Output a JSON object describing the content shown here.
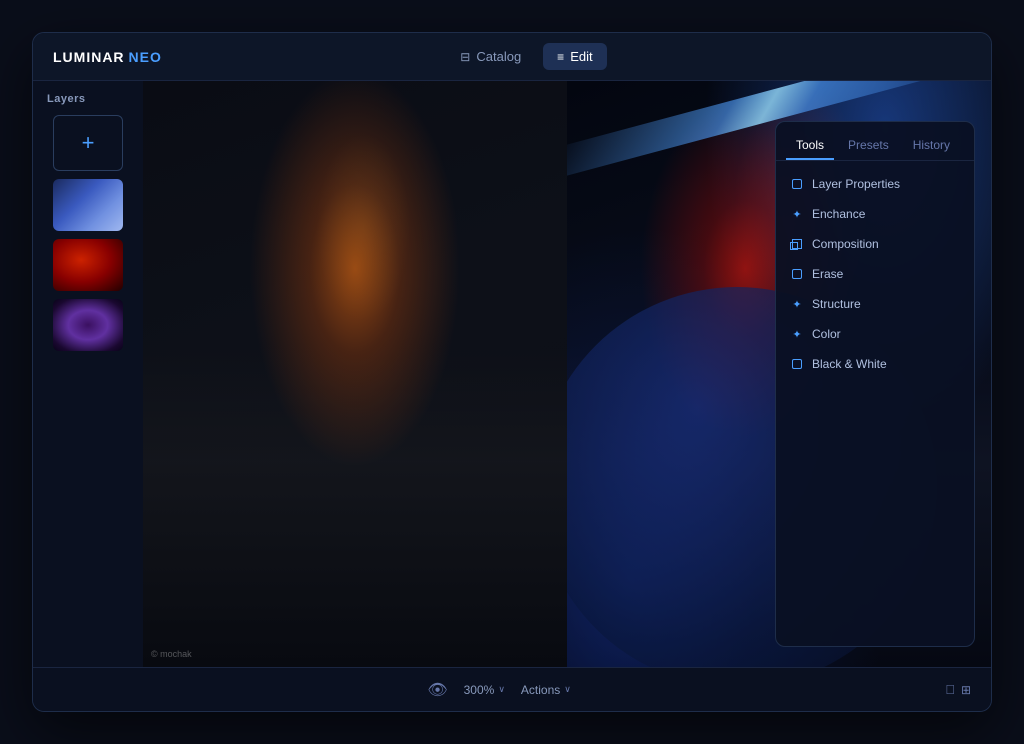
{
  "app": {
    "title_luminar": "LUMINAR",
    "title_neo": "NEO"
  },
  "titlebar": {
    "catalog_label": "Catalog",
    "edit_label": "Edit"
  },
  "layers": {
    "label": "Layers",
    "add_button_icon": "+"
  },
  "tools_panel": {
    "tabs": [
      {
        "id": "tools",
        "label": "Tools",
        "active": true
      },
      {
        "id": "presets",
        "label": "Presets",
        "active": false
      },
      {
        "id": "history",
        "label": "History",
        "active": false
      }
    ],
    "items": [
      {
        "id": "layer-properties",
        "label": "Layer Properties",
        "icon": "square"
      },
      {
        "id": "enchance",
        "label": "Enchance",
        "icon": "star"
      },
      {
        "id": "composition",
        "label": "Composition",
        "icon": "compose"
      },
      {
        "id": "erase",
        "label": "Erase",
        "icon": "square"
      },
      {
        "id": "structure",
        "label": "Structure",
        "icon": "gear"
      },
      {
        "id": "color",
        "label": "Color",
        "icon": "circle"
      },
      {
        "id": "black-white",
        "label": "Black & White",
        "icon": "square"
      }
    ]
  },
  "bottombar": {
    "zoom_value": "300%",
    "zoom_arrow": "∨",
    "actions_label": "Actions",
    "actions_arrow": "∨",
    "eye_icon": "👁",
    "apple_icon": "⌘",
    "windows_icon": "⊞"
  },
  "watermark": {
    "text": "© mochak"
  }
}
